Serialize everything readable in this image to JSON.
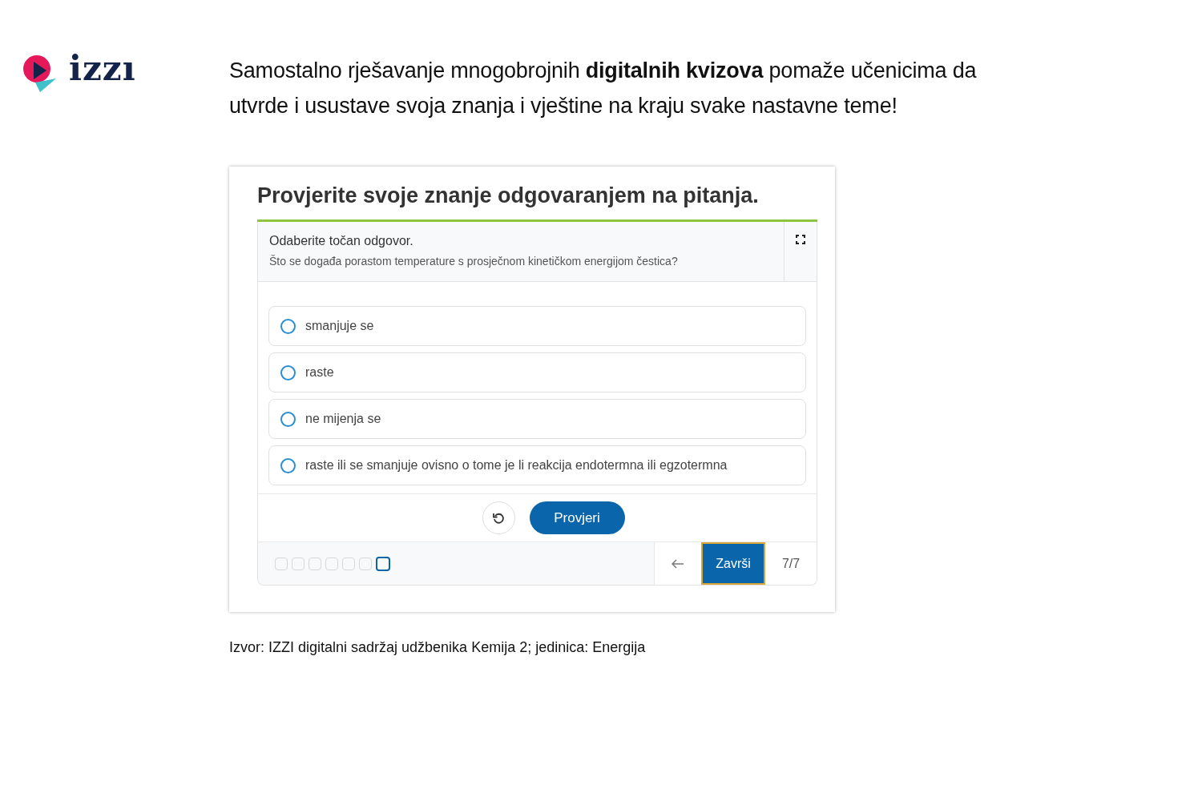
{
  "logo": {
    "text": "izzı"
  },
  "headline": "Samostalno rješavanje mnogobrojnih **digitalnih kvizova** pomaže učenicima da utvrde i usustave svoja znanja i vještine na kraju svake nastavne teme!",
  "quiz": {
    "title": "Provjerite svoje znanje odgovaranjem na pitanja.",
    "instruction": "Odaberite točan odgovor.",
    "question": "Što se događa porastom temperature s prosječnom kinetičkom energijom čestica?",
    "options": [
      {
        "label": "smanjuje se",
        "selected": false
      },
      {
        "label": "raste",
        "selected": false
      },
      {
        "label": "ne mijenja se",
        "selected": false
      },
      {
        "label": "raste ili se smanjuje ovisno o tome je li reakcija endotermna ili egzotermna",
        "selected": false
      }
    ],
    "check_button": "Provjeri",
    "progress": [
      {
        "selected": false
      },
      {
        "selected": false
      },
      {
        "selected": false
      },
      {
        "selected": false
      },
      {
        "selected": false
      },
      {
        "selected": false
      },
      {
        "selected": true
      }
    ],
    "finish_button": "Završi",
    "page_counter": "7/7"
  },
  "caption": "Izvor: IZZI digitalni sadržaj udžbenika Kemija 2; jedinica: Energija"
}
